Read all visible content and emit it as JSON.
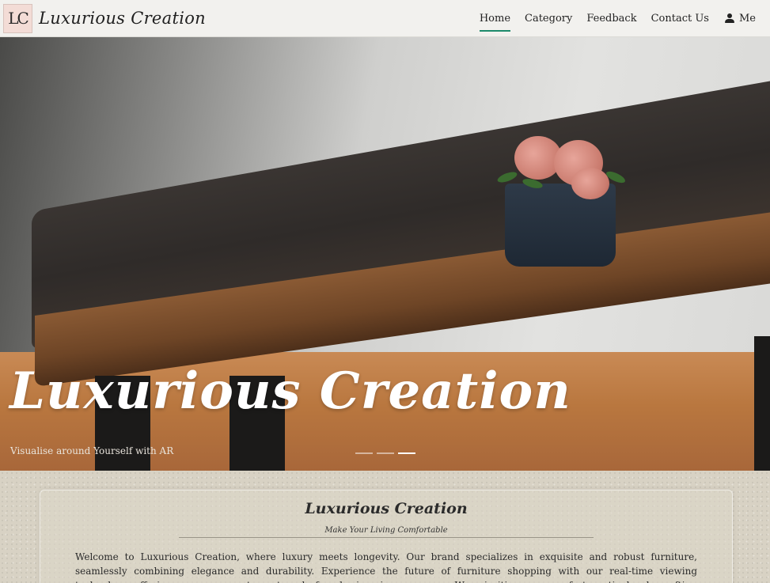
{
  "brand": {
    "logo_text": "LC",
    "name": "Luxurious Creation"
  },
  "nav": {
    "items": [
      {
        "label": "Home",
        "active": true
      },
      {
        "label": "Category",
        "active": false
      },
      {
        "label": "Feedback",
        "active": false
      },
      {
        "label": "Contact Us",
        "active": false
      }
    ],
    "account_label": "Me",
    "account_icon": "user-icon",
    "active_color": "#1d8a6b"
  },
  "hero": {
    "title": "Luxurious Creation",
    "subtitle": "Visualise around Yourself with AR",
    "slides_count": 3,
    "active_slide": 3
  },
  "about": {
    "title": "Luxurious Creation",
    "tagline": "Make Your Living Comfortable",
    "text": "Welcome to Luxurious Creation, where luxury meets longevity. Our brand specializes in exquisite and robust furniture, seamlessly combining elegance and durability. Experience the future of furniture shopping with our real-time viewing technology, offering you an accurate portrayal of each piece in your space. We prioritize your comfort, meticulously crafting every item to provide an oasis of relaxation. Dive into a world of"
  }
}
